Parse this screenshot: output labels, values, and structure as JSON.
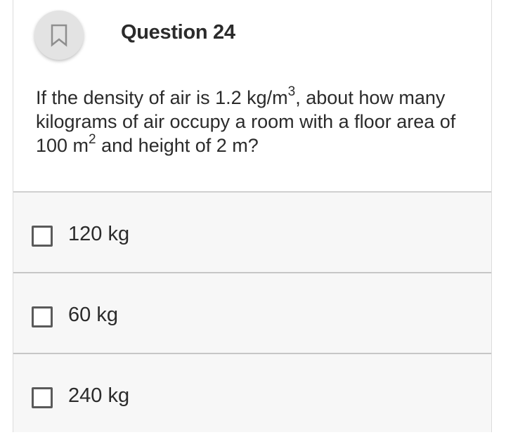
{
  "question": {
    "bookmark_icon": "bookmark-icon",
    "title": "Question 24",
    "text_part1": "If the density of air is 1.2 kg/m",
    "text_sup1": "3",
    "text_part2": ", about how many kilograms of air occupy a room with a floor area of 100 m",
    "text_sup2": "2",
    "text_part3": " and height of 2 m?"
  },
  "options": [
    {
      "label": "120 kg",
      "checked": false
    },
    {
      "label": "60 kg",
      "checked": false
    },
    {
      "label": "240 kg",
      "checked": false
    }
  ]
}
